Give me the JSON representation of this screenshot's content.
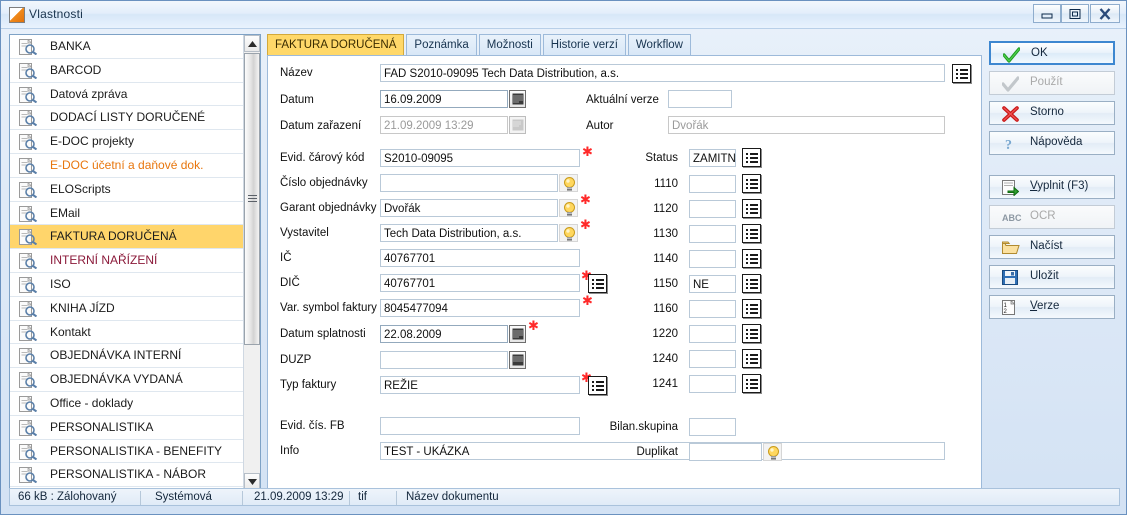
{
  "window": {
    "title": "Vlastnosti",
    "icon": "document-properties-icon",
    "controls": {
      "minimize": "minimize-icon",
      "maximize": "maximize-icon",
      "close": "close-icon"
    }
  },
  "sidebar": {
    "items": [
      {
        "label": "BANKA",
        "state": "normal"
      },
      {
        "label": "BARCOD",
        "state": "normal"
      },
      {
        "label": "Datová zpráva",
        "state": "normal"
      },
      {
        "label": "DODACÍ LISTY DORUČENÉ",
        "state": "normal"
      },
      {
        "label": "E-DOC projekty",
        "state": "normal"
      },
      {
        "label": "E-DOC účetní a daňové dok.",
        "state": "orange"
      },
      {
        "label": "ELOScripts",
        "state": "normal"
      },
      {
        "label": "EMail",
        "state": "normal"
      },
      {
        "label": "FAKTURA DORUČENÁ",
        "state": "selected"
      },
      {
        "label": "INTERNÍ NAŘÍZENÍ",
        "state": "maroon"
      },
      {
        "label": "ISO",
        "state": "normal"
      },
      {
        "label": "KNIHA JÍZD",
        "state": "normal"
      },
      {
        "label": "Kontakt",
        "state": "normal"
      },
      {
        "label": "OBJEDNÁVKA INTERNÍ",
        "state": "normal"
      },
      {
        "label": "OBJEDNÁVKA VYDANÁ",
        "state": "normal"
      },
      {
        "label": "Office - doklady",
        "state": "normal"
      },
      {
        "label": "PERSONALISTIKA",
        "state": "normal"
      },
      {
        "label": "PERSONALISTIKA - BENEFITY",
        "state": "normal"
      },
      {
        "label": "PERSONALISTIKA - NÁBOR",
        "state": "normal"
      }
    ],
    "scrollbar": {
      "up": "scroll-up-arrow-icon",
      "down": "scroll-down-arrow-icon"
    }
  },
  "tabs": [
    {
      "label": "FAKTURA DORUČENÁ",
      "active": true
    },
    {
      "label": "Poznámka",
      "active": false
    },
    {
      "label": "Možnosti",
      "active": false
    },
    {
      "label": "Historie verzí",
      "active": false
    },
    {
      "label": "Workflow",
      "active": false
    }
  ],
  "form": {
    "nazev": {
      "label": "Název",
      "value": "FAD S2010-09095 Tech Data Distribution, a.s."
    },
    "datum": {
      "label": "Datum",
      "value": "16.09.2009"
    },
    "datum_zarazeni": {
      "label": "Datum zařazení",
      "value": "21.09.2009 13:29"
    },
    "evid_carovy_kod": {
      "label": "Evid. čárový kód",
      "value": "S2010-09095"
    },
    "cislo_objednavky": {
      "label": "Číslo objednávky",
      "value": ""
    },
    "garant_objednavky": {
      "label": "Garant objednávky",
      "value": "Dvořák"
    },
    "vystavitel": {
      "label": "Vystavitel",
      "value": "Tech Data Distribution, a.s."
    },
    "ic": {
      "label": "IČ",
      "value": "40767701"
    },
    "dic": {
      "label": "DIČ",
      "value": "40767701"
    },
    "var_symbol": {
      "label": "Var. symbol faktury",
      "value": "8045477094"
    },
    "datum_splatnosti": {
      "label": "Datum splatnosti",
      "value": "22.08.2009"
    },
    "duzp": {
      "label": "DUZP",
      "value": ""
    },
    "typ_faktury": {
      "label": "Typ faktury",
      "value": "REŽIE"
    },
    "evid_cis_fb": {
      "label": "Evid. čís. FB",
      "value": ""
    },
    "info": {
      "label": "Info",
      "value": "TEST - UKÁZKA"
    },
    "aktualni_verze": {
      "label": "Aktuální verze",
      "value": ""
    },
    "autor": {
      "label": "Autor",
      "value": "Dvořák"
    },
    "status": {
      "label": "Status",
      "value": "ZAMITNU"
    },
    "codes": [
      {
        "label": "1110",
        "value": ""
      },
      {
        "label": "1120",
        "value": ""
      },
      {
        "label": "1130",
        "value": ""
      },
      {
        "label": "1140",
        "value": ""
      },
      {
        "label": "1150",
        "value": "NE"
      },
      {
        "label": "1160",
        "value": ""
      },
      {
        "label": "1220",
        "value": ""
      },
      {
        "label": "1240",
        "value": ""
      },
      {
        "label": "1241",
        "value": ""
      }
    ],
    "bilan_skupina": {
      "label": "Bilan.skupina",
      "value": ""
    },
    "duplikat": {
      "label": "Duplikat",
      "value": ""
    }
  },
  "buttons": [
    {
      "label": "OK",
      "icon": "green-check-icon",
      "style": "primary"
    },
    {
      "label": "Použít",
      "icon": "gray-check-icon",
      "style": "disabled"
    },
    {
      "label": "Storno",
      "icon": "red-x-icon",
      "style": "normal"
    },
    {
      "label": "Nápověda",
      "icon": "question-mark-icon",
      "style": "normal"
    },
    {
      "label": "Vyplnit (F3)",
      "icon": "fill-form-icon",
      "style": "normal",
      "accel": "V"
    },
    {
      "label": "OCR",
      "icon": "abc-ocr-icon",
      "style": "disabled"
    },
    {
      "label": "Načíst",
      "icon": "open-folder-icon",
      "style": "normal"
    },
    {
      "label": "Uložit",
      "icon": "floppy-save-icon",
      "style": "normal"
    },
    {
      "label": "Verze",
      "icon": "versions-icon",
      "style": "normal",
      "accel": "V"
    }
  ],
  "statusbar": {
    "size": "66 kB : Zálohovaný",
    "kind": "Systémová",
    "timestamp": "21.09.2009 13:29",
    "filetype": "tif",
    "docname": "Název dokumentu"
  },
  "colors": {
    "selection": "#ffd56b",
    "orange_item": "#e8760d",
    "maroon_item": "#8b1a3a",
    "active_tab": "#ffd869",
    "required_star": "#ff2a2a",
    "window_bg": "#d8e6f5"
  }
}
